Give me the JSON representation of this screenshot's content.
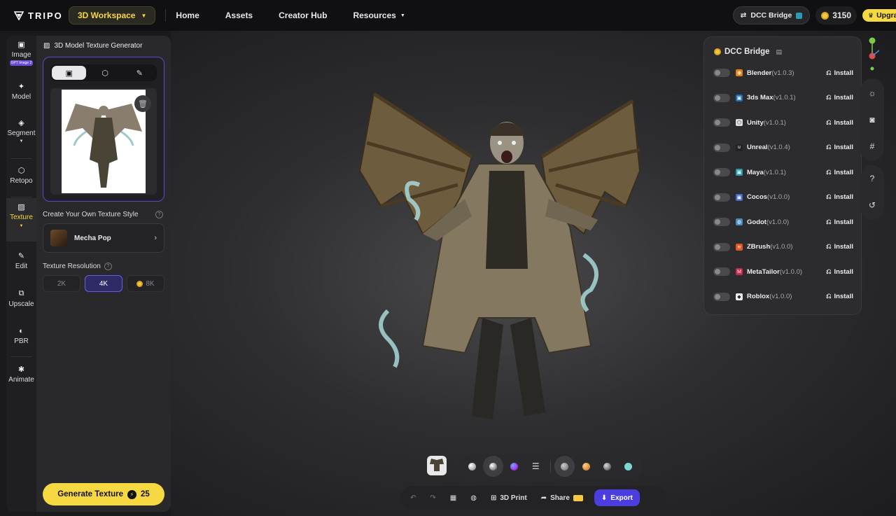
{
  "topnav": {
    "logo_text": "TRIPO",
    "workspace_label": "3D Workspace",
    "links": [
      "Home",
      "Assets",
      "Creator Hub",
      "Resources"
    ],
    "dcc_bridge_label": "DCC Bridge",
    "credits": "3150",
    "upgrade_label": "Upgra"
  },
  "rail": {
    "items": [
      {
        "label": "Image",
        "badge": "GPT Image 2",
        "icon": "image-icon"
      },
      {
        "label": "Model",
        "icon": "sparkle-icon"
      },
      {
        "label": "Segment",
        "icon": "cube-split-icon"
      },
      {
        "label": "Retopo",
        "icon": "mesh-icon"
      },
      {
        "label": "Texture",
        "icon": "texture-icon"
      },
      {
        "label": "Edit",
        "icon": "brush-icon"
      },
      {
        "label": "Upscale",
        "icon": "upscale-icon"
      },
      {
        "label": "PBR",
        "icon": "pbr-icon"
      },
      {
        "label": "Animate",
        "icon": "figure-icon"
      }
    ],
    "active": "Texture"
  },
  "panel": {
    "title": "3D Model Texture Generator",
    "style_heading": "Create Your Own Texture Style",
    "style_selected": "Mecha Pop",
    "resolution_heading": "Texture Resolution",
    "resolutions": [
      "2K",
      "4K",
      "8K"
    ],
    "resolution_selected": "4K",
    "generate_label": "Generate Texture",
    "generate_cost": "25"
  },
  "dcc_panel": {
    "title": "DCC Bridge",
    "install_label": "Install",
    "apps": [
      {
        "name": "Blender",
        "version": "(v1.0.3)",
        "color": "#e87d0d"
      },
      {
        "name": "3ds Max",
        "version": "(v1.0.1)",
        "color": "#1e6fb8"
      },
      {
        "name": "Unity",
        "version": "(v1.0.1)",
        "color": "#dddddd"
      },
      {
        "name": "Unreal",
        "version": "(v1.0.4)",
        "color": "#222222"
      },
      {
        "name": "Maya",
        "version": "(v1.0.1)",
        "color": "#2a9bb5"
      },
      {
        "name": "Cocos",
        "version": "(v1.0.0)",
        "color": "#3f6bd1"
      },
      {
        "name": "Godot",
        "version": "(v1.0.0)",
        "color": "#478cbf"
      },
      {
        "name": "ZBrush",
        "version": "(v1.0.0)",
        "color": "#e8531f"
      },
      {
        "name": "MetaTailor",
        "version": "(v1.0.0)",
        "color": "#cc2a4a"
      },
      {
        "name": "Roblox",
        "version": "(v1.0.0)",
        "color": "#eeeeee"
      }
    ]
  },
  "bottom": {
    "print_label": "3D Print",
    "share_label": "Share",
    "export_label": "Export"
  }
}
